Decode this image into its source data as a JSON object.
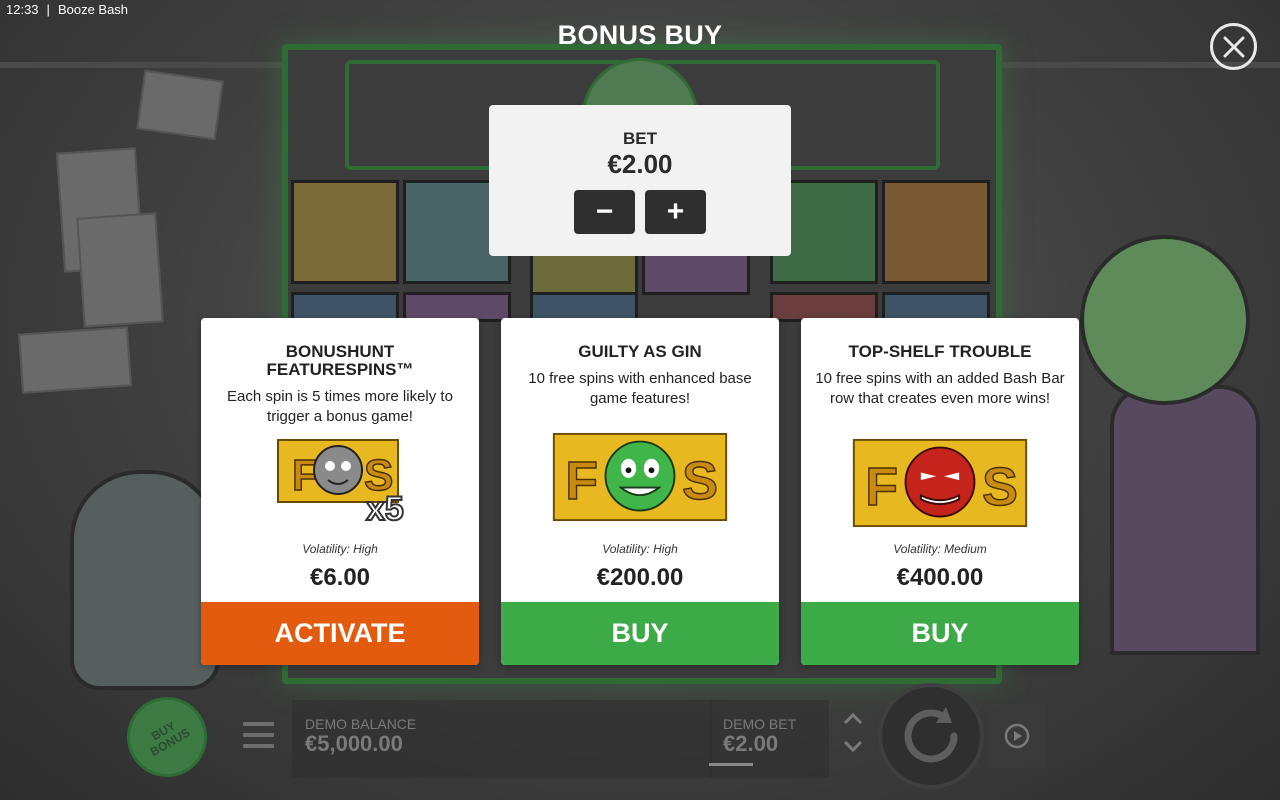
{
  "status_bar": {
    "time": "12:33",
    "app_name": "Booze Bash"
  },
  "title": "BONUS BUY",
  "close_icon": "close-icon",
  "bet_panel": {
    "label": "BET",
    "value": "€2.00",
    "decrease_symbol": "−",
    "increase_symbol": "+"
  },
  "cards": [
    {
      "title": "BONUSHUNT FEATURESPINS™",
      "description": "Each spin is 5 times more likely to trigger a bonus game!",
      "art_badge": "x5",
      "art_color": "#888888",
      "volatility": "Volatility: High",
      "price": "€6.00",
      "action": "ACTIVATE",
      "action_color": "#e35b0e"
    },
    {
      "title": "GUILTY AS GIN",
      "description": "10 free spins with enhanced base game features!",
      "art_color": "#3fb54a",
      "volatility": "Volatility: High",
      "price": "€200.00",
      "action": "BUY",
      "action_color": "#3daa48"
    },
    {
      "title": "TOP-SHELF TROUBLE",
      "description": "10 free spins with an added Bash Bar row that creates even more wins!",
      "art_color": "#c4241b",
      "volatility": "Volatility: Medium",
      "price": "€400.00",
      "action": "BUY",
      "action_color": "#3daa48"
    }
  ],
  "bottom_bar": {
    "buy_bonus_label": "BUY BONUS",
    "balance_label": "DEMO BALANCE",
    "balance_value": "€5,000.00",
    "bet_label": "DEMO BET",
    "bet_value": "€2.00"
  },
  "colors": {
    "activate": "#e35b0e",
    "buy": "#3daa48",
    "panel_bg": "#f2f2f2"
  }
}
